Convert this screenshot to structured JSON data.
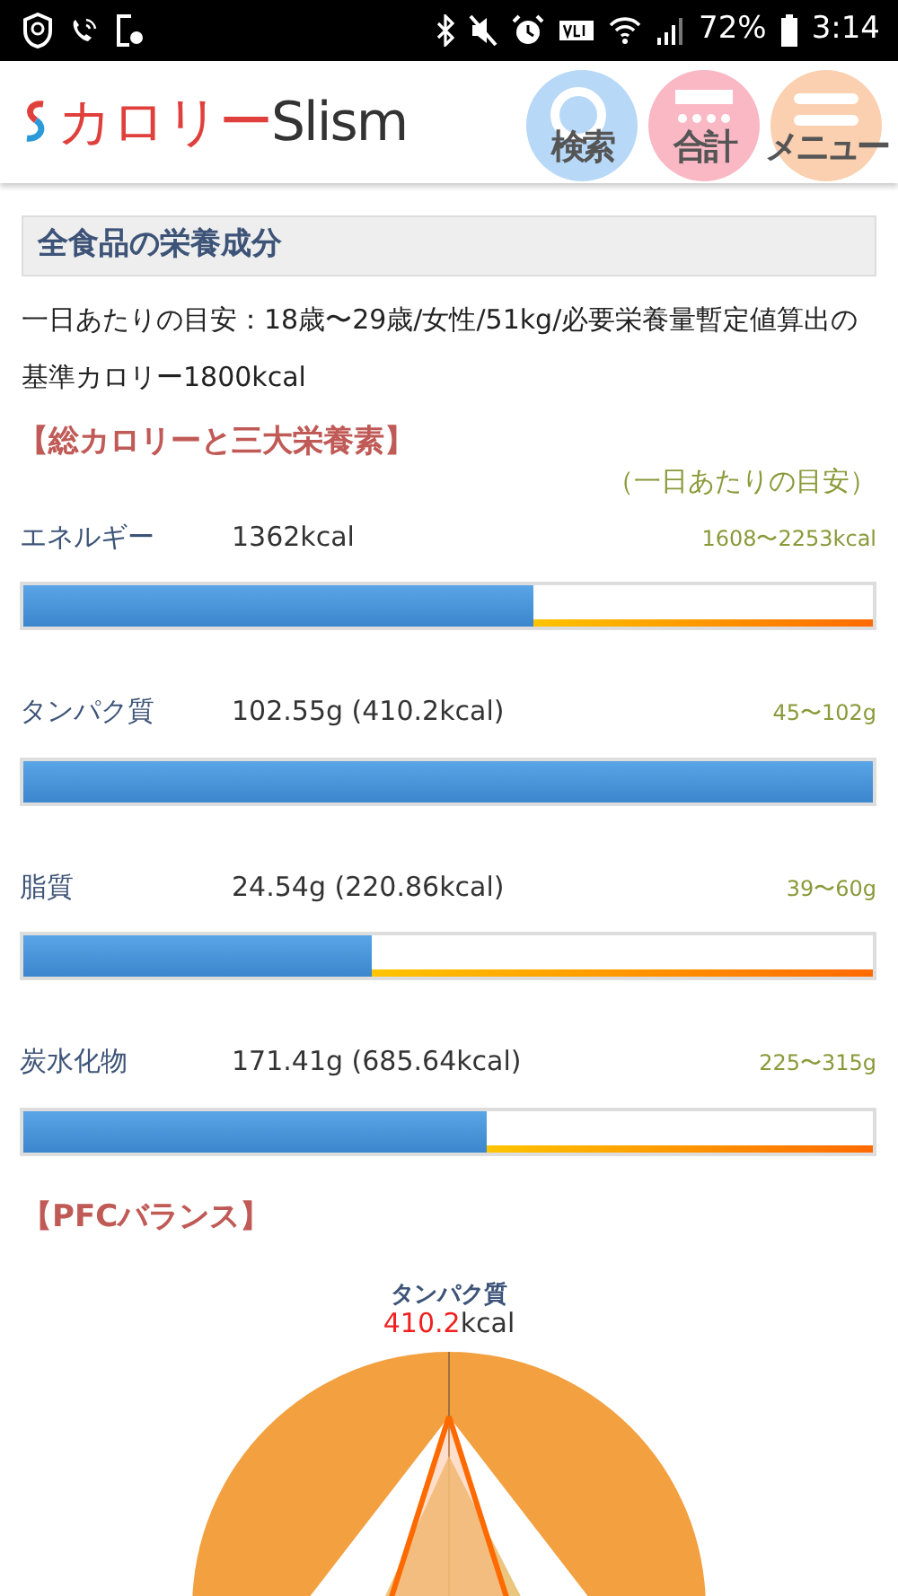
{
  "status_bar": {
    "battery": "72%",
    "time": "3:14"
  },
  "header": {
    "logo_kana": "カロリー",
    "logo_latin": "Slism",
    "nav": [
      {
        "label": "検索",
        "kind": "search"
      },
      {
        "label": "合計",
        "kind": "calculator"
      },
      {
        "label": "メニュー",
        "kind": "menu"
      }
    ]
  },
  "section_title": "全食品の栄養成分",
  "description": "一日あたりの目安：18歳〜29歳/女性/51kg/必要栄養量暫定値算出の基準カロリー1800kcal",
  "macros": {
    "title": "【総カロリーと三大栄養素】",
    "reference_label": "（一日あたりの目安）",
    "rows": [
      {
        "name": "エネルギー",
        "amount": "1362kcal",
        "range": "1608〜2253kcal",
        "level": 0.6
      },
      {
        "name": "タンパク質",
        "amount": "102.55g (410.2kcal)",
        "range": "45〜102g",
        "level": 1
      },
      {
        "name": "脂質",
        "amount": "24.54g (220.86kcal)",
        "range": "39〜60g",
        "level": 0.41
      },
      {
        "name": "炭水化物",
        "amount": "171.41g (685.64kcal)",
        "range": "225〜315g",
        "level": 0.545
      }
    ]
  },
  "pfc": {
    "title": "【PFCバランス】",
    "axis_label": "タンパク質",
    "axis_value": "410.2",
    "axis_unit": "kcal"
  }
}
